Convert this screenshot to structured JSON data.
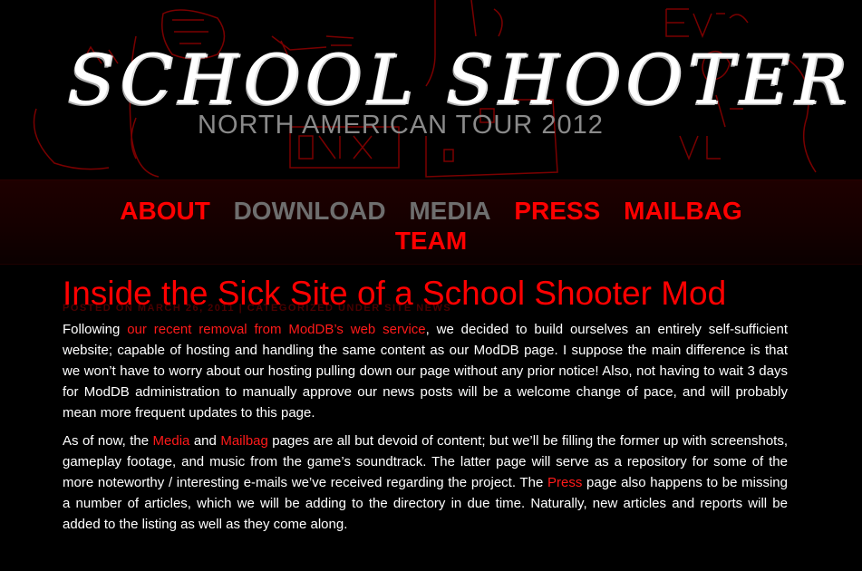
{
  "header": {
    "logo_title": "SCHOOL SHOOTER",
    "logo_subtitle": "NORTH AMERICAN TOUR 2012"
  },
  "nav": {
    "items": [
      {
        "label": "ABOUT",
        "color": "#ff0000"
      },
      {
        "label": "DOWNLOAD",
        "color": "#6e6e6e"
      },
      {
        "label": "MEDIA",
        "color": "#6e6e6e"
      },
      {
        "label": "PRESS",
        "color": "#ff0000"
      },
      {
        "label": "MAILBAG",
        "color": "#ff0000"
      },
      {
        "label": "TEAM",
        "color": "#ff0000"
      }
    ]
  },
  "post": {
    "title": "Inside the Sick Site of a School Shooter Mod",
    "meta": "POSTED ON MARCH 26, 2011 | CATEGORIZED UNDER SITE NEWS",
    "p1": {
      "pre": "Following ",
      "link": "our recent removal from ModDB’s web service",
      "post": ", we decided to build ourselves an entirely self-sufficient website; capable of hosting and handling the same content as our ModDB page. I suppose the main difference is that we won’t have to worry about our hosting pulling down our page without any prior notice! Also, not having to wait 3 days for ModDB administration to manually approve our news posts will be a welcome change of pace, and will probably mean more frequent updates to this page."
    },
    "p2": {
      "t1": "As of now, the ",
      "link_media": "Media",
      "t2": " and ",
      "link_mailbag": "Mailbag",
      "t3": " pages are all but devoid of content; but we’ll be filling the former up with screenshots, gameplay footage, and music from the game’s soundtrack. The latter page will serve as a repository for some of the more noteworthy / interesting e-mails we’ve received regarding the project. The ",
      "link_press": "Press",
      "t4": " page also happens to be missing a number of articles, which we will be adding to the directory in due time. Naturally, new articles and reports will be added to the listing as well as they come along."
    }
  }
}
